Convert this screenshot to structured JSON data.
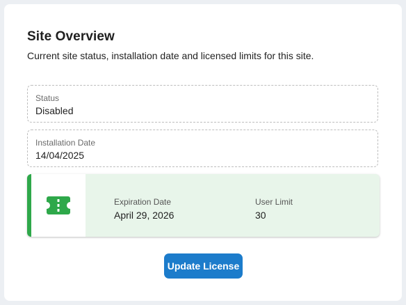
{
  "page": {
    "title": "Site Overview",
    "subtitle": "Current site status, installation date and licensed limits for this site."
  },
  "fields": {
    "status": {
      "label": "Status",
      "value": "Disabled"
    },
    "installation_date": {
      "label": "Installation Date",
      "value": "14/04/2025"
    }
  },
  "license": {
    "icon": "ticket-icon",
    "expiration_label": "Expiration Date",
    "expiration_value": "April 29, 2026",
    "user_limit_label": "User Limit",
    "user_limit_value": "30"
  },
  "actions": {
    "update_label": "Update License"
  },
  "colors": {
    "accent_green": "#2ea84a",
    "panel_bg": "#e8f5ea",
    "primary_button": "#1c7ccb"
  }
}
